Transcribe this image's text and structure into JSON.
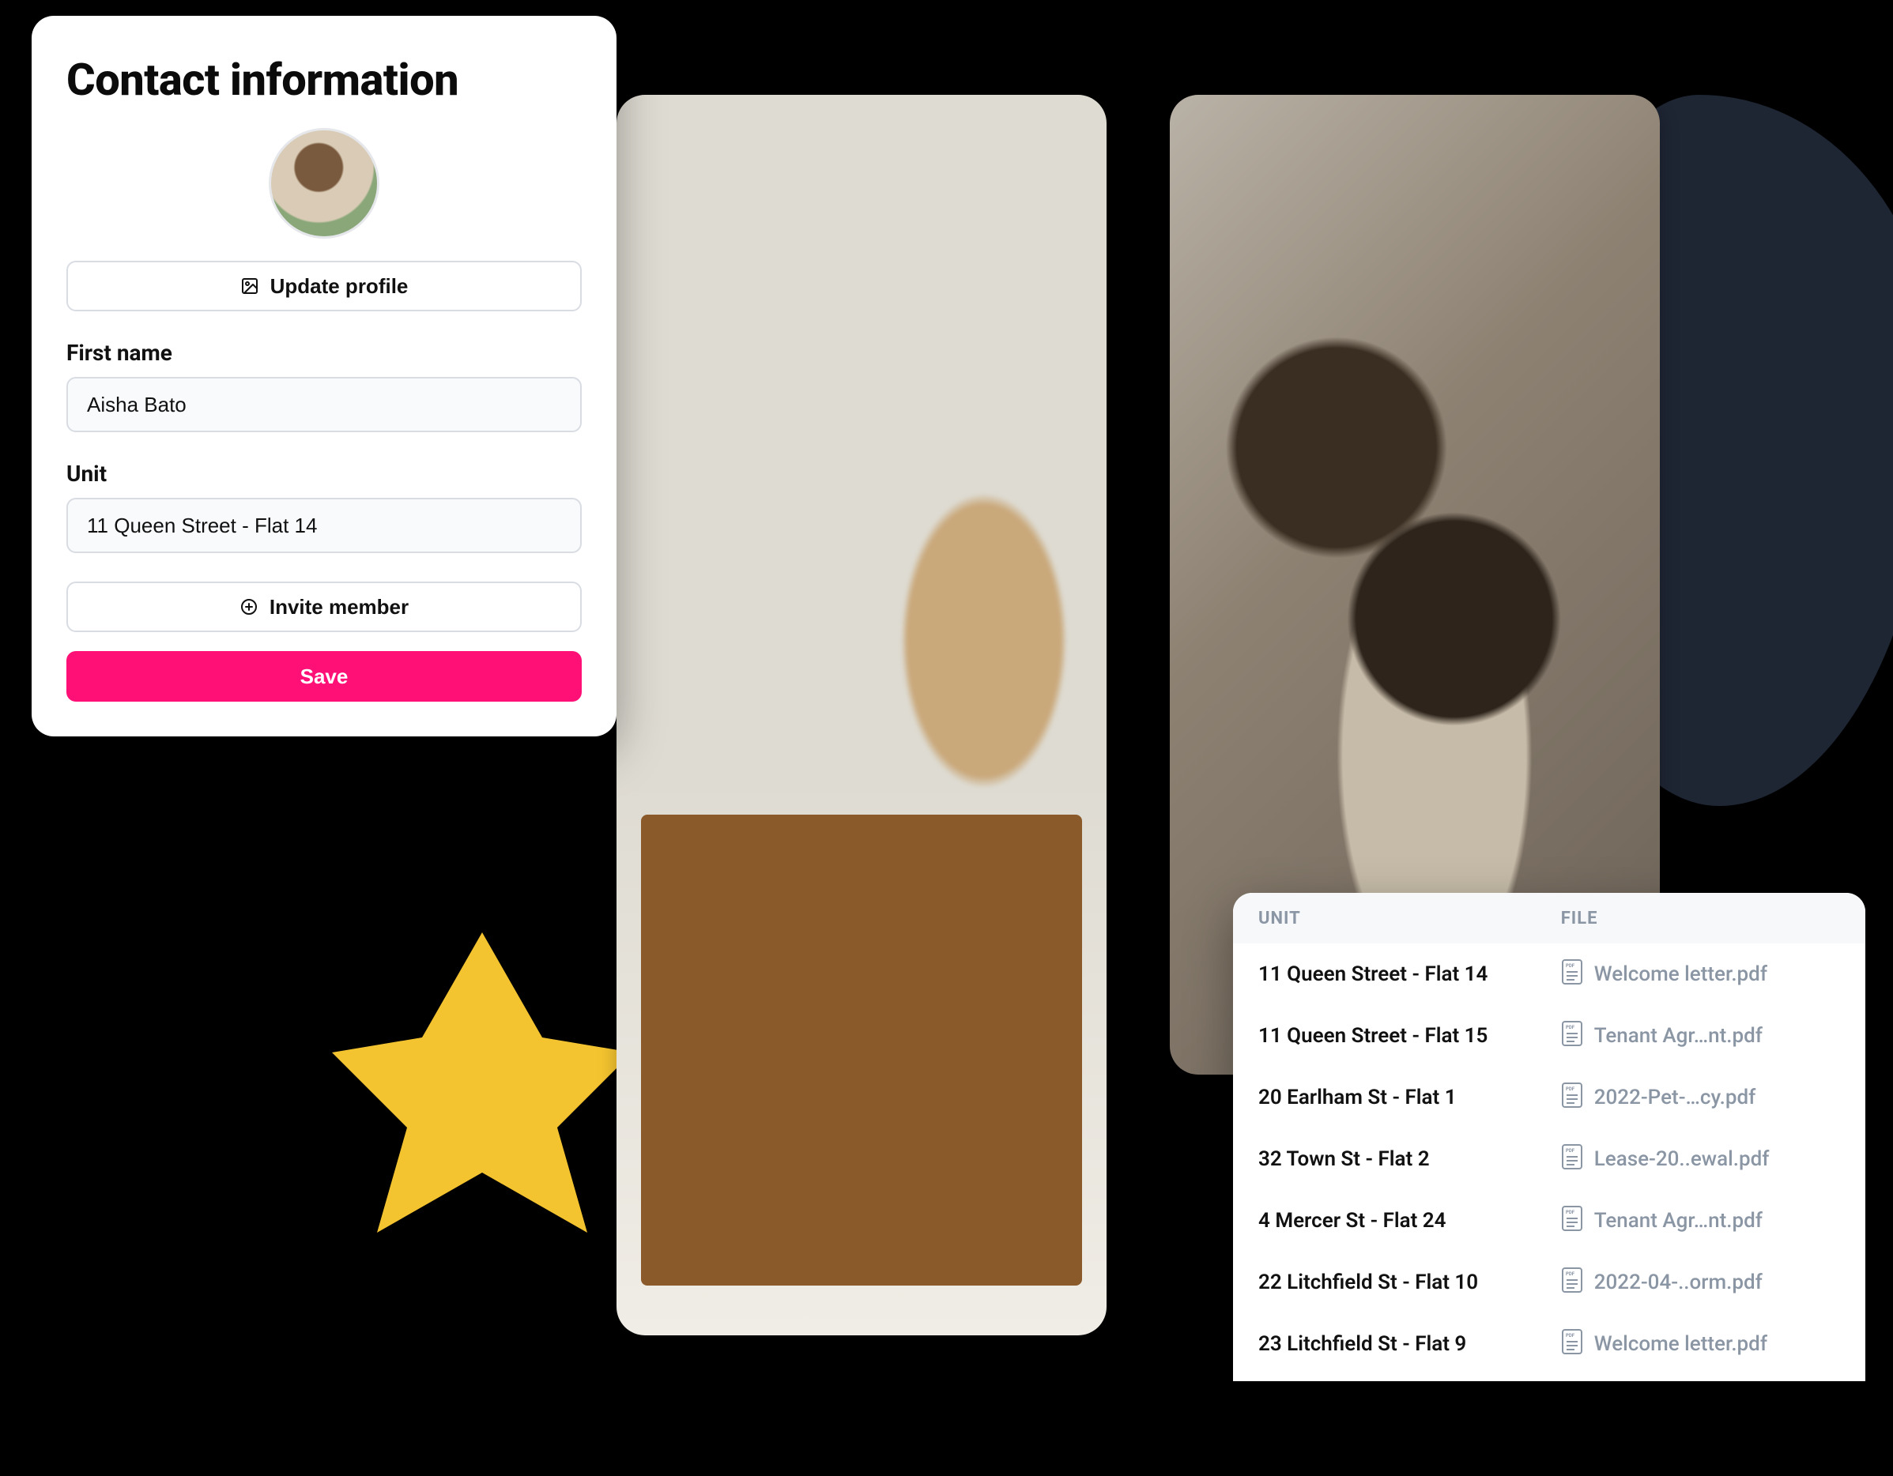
{
  "contact": {
    "title": "Contact information",
    "update_profile_label": "Update profile",
    "first_name_label": "First name",
    "first_name_value": "Aisha Bato",
    "unit_label": "Unit",
    "unit_value": "11 Queen Street - Flat 14",
    "invite_member_label": "Invite member",
    "save_label": "Save"
  },
  "files": {
    "header_unit": "UNIT",
    "header_file": "FILE",
    "rows": [
      {
        "unit": "11 Queen Street - Flat 14",
        "file": "Welcome letter.pdf"
      },
      {
        "unit": "11 Queen Street - Flat 15",
        "file": "Tenant Agr…nt.pdf"
      },
      {
        "unit": "20 Earlham St - Flat 1",
        "file": "2022-Pet-…cy.pdf"
      },
      {
        "unit": "32 Town St - Flat 2",
        "file": "Lease-20..ewal.pdf"
      },
      {
        "unit": "4 Mercer St - Flat 24",
        "file": "Tenant Agr…nt.pdf"
      },
      {
        "unit": "22 Litchfield St - Flat 10",
        "file": "2022-04-..orm.pdf"
      },
      {
        "unit": "23 Litchfield St - Flat 9",
        "file": "Welcome letter.pdf"
      }
    ]
  },
  "colors": {
    "primary": "#ff1077",
    "blob_yellow": "#f4c430",
    "blob_dark": "#1e2533"
  }
}
